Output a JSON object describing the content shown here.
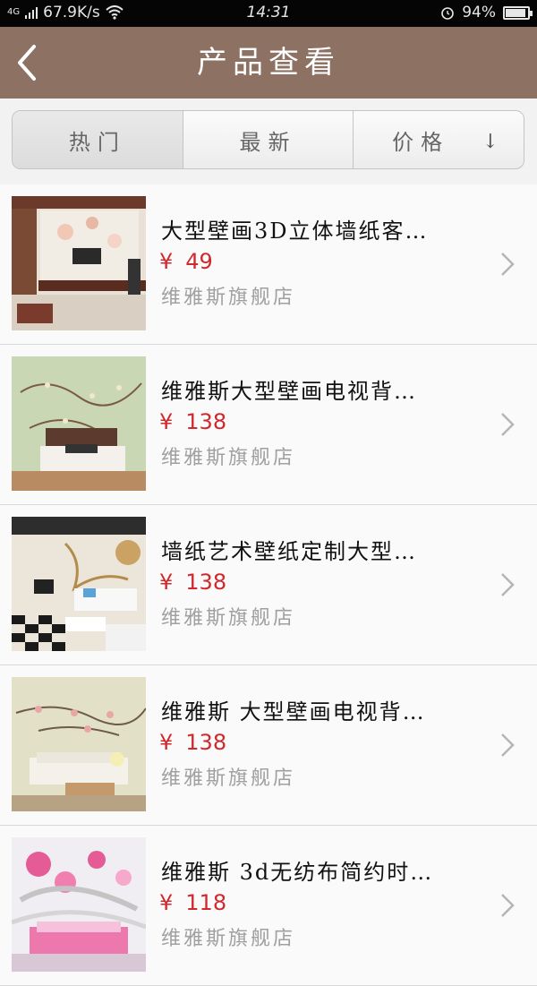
{
  "status_bar": {
    "signal": "4G",
    "speed": "67.9K/s",
    "time": "14:31",
    "battery": "94%",
    "battery_level": 0.94
  },
  "header": {
    "title": "产品查看"
  },
  "tabs": [
    {
      "label": "热门"
    },
    {
      "label": "最新"
    },
    {
      "label": "价格",
      "arrow": "↓"
    }
  ],
  "products": [
    {
      "title": "大型壁画3D立体墙纸客…",
      "currency": "¥",
      "price": "49",
      "shop": "维雅斯旗舰店",
      "image": "living-room-tv-wall-mural"
    },
    {
      "title": "维雅斯大型壁画电视背…",
      "currency": "¥",
      "price": "138",
      "shop": "维雅斯旗舰店",
      "image": "bedroom-green-branch-mural"
    },
    {
      "title": "墙纸艺术壁纸定制大型…",
      "currency": "¥",
      "price": "138",
      "shop": "维雅斯旗舰店",
      "image": "checkered-floor-lotus-mural"
    },
    {
      "title": "维雅斯 大型壁画电视背…",
      "currency": "¥",
      "price": "138",
      "shop": "维雅斯旗舰店",
      "image": "sofa-pink-blossom-mural"
    },
    {
      "title": "维雅斯 3d无纺布简约时…",
      "currency": "¥",
      "price": "118",
      "shop": "维雅斯旗舰店",
      "image": "pink-flower-bedroom-mural"
    }
  ]
}
